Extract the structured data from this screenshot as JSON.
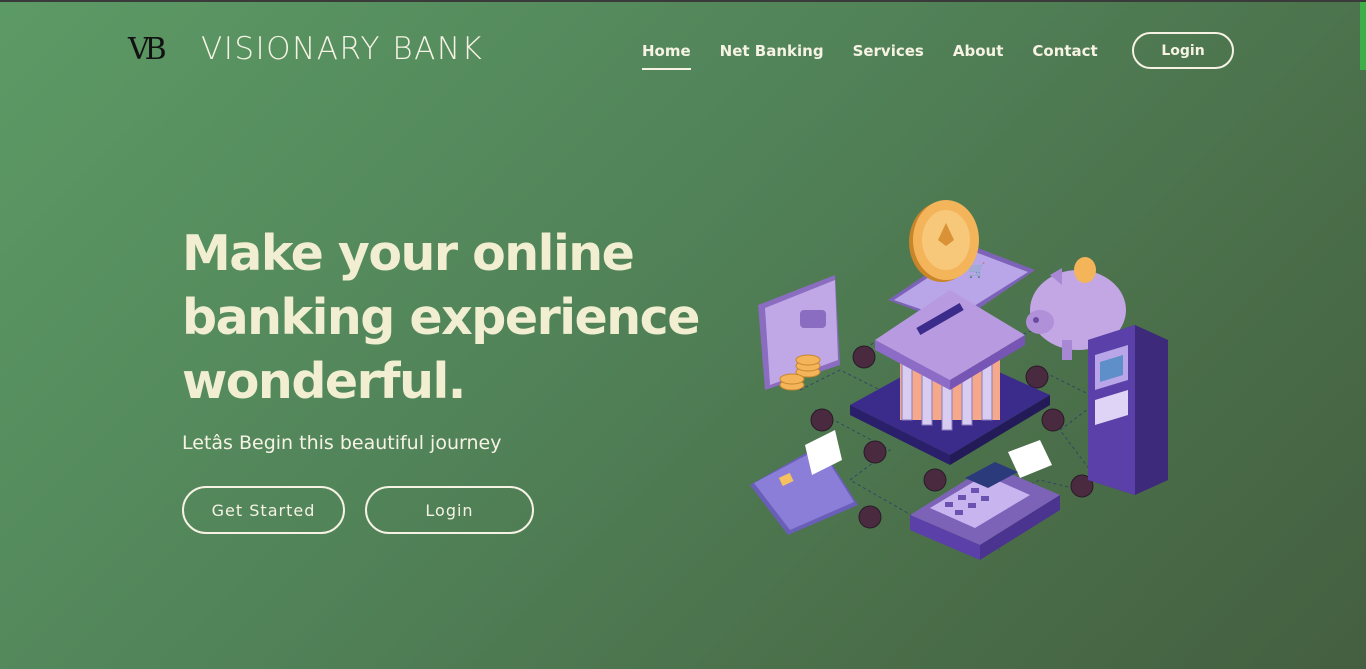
{
  "brand": {
    "mark": "VB",
    "name": "VISIONARY BANK"
  },
  "nav": {
    "links": [
      {
        "label": "Home",
        "active": true
      },
      {
        "label": "Net Banking",
        "active": false
      },
      {
        "label": "Services",
        "active": false
      },
      {
        "label": "About",
        "active": false
      },
      {
        "label": "Contact",
        "active": false
      }
    ],
    "login_label": "Login"
  },
  "hero": {
    "title": "Make your online banking experience wonderful.",
    "subtitle": "Letâs Begin this beautiful journey",
    "primary_button": "Get Started",
    "secondary_button": "Login"
  },
  "icons": {
    "brand_logo": "vb-monogram-icon",
    "illustration": "online-banking-isometric-illustration"
  },
  "colors": {
    "background_start": "#5c9a65",
    "background_end": "#445f40",
    "text": "#f1eed2",
    "accent_purple": "#a88bd6"
  }
}
